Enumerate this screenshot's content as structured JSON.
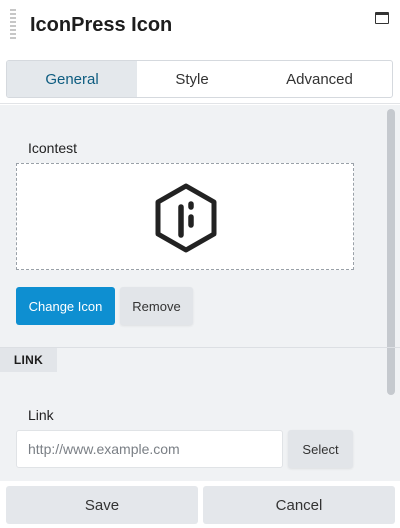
{
  "window": {
    "title": "IconPress Icon"
  },
  "tabs": [
    {
      "label": "General",
      "active": true
    },
    {
      "label": "Style",
      "active": false
    },
    {
      "label": "Advanced",
      "active": false
    }
  ],
  "icon_field": {
    "label": "Icontest",
    "preview_icon": "iconpress-hexagon-logo-icon",
    "change_label": "Change Icon",
    "remove_label": "Remove"
  },
  "link_section": {
    "heading": "LINK",
    "field_label": "Link",
    "input_value": "",
    "input_placeholder": "http://www.example.com",
    "select_label": "Select"
  },
  "footer": {
    "save_label": "Save",
    "cancel_label": "Cancel"
  },
  "colors": {
    "accent": "#0e8fd1",
    "active_tab_text": "#0d5c80",
    "panel_bg": "#f0f2f4"
  }
}
